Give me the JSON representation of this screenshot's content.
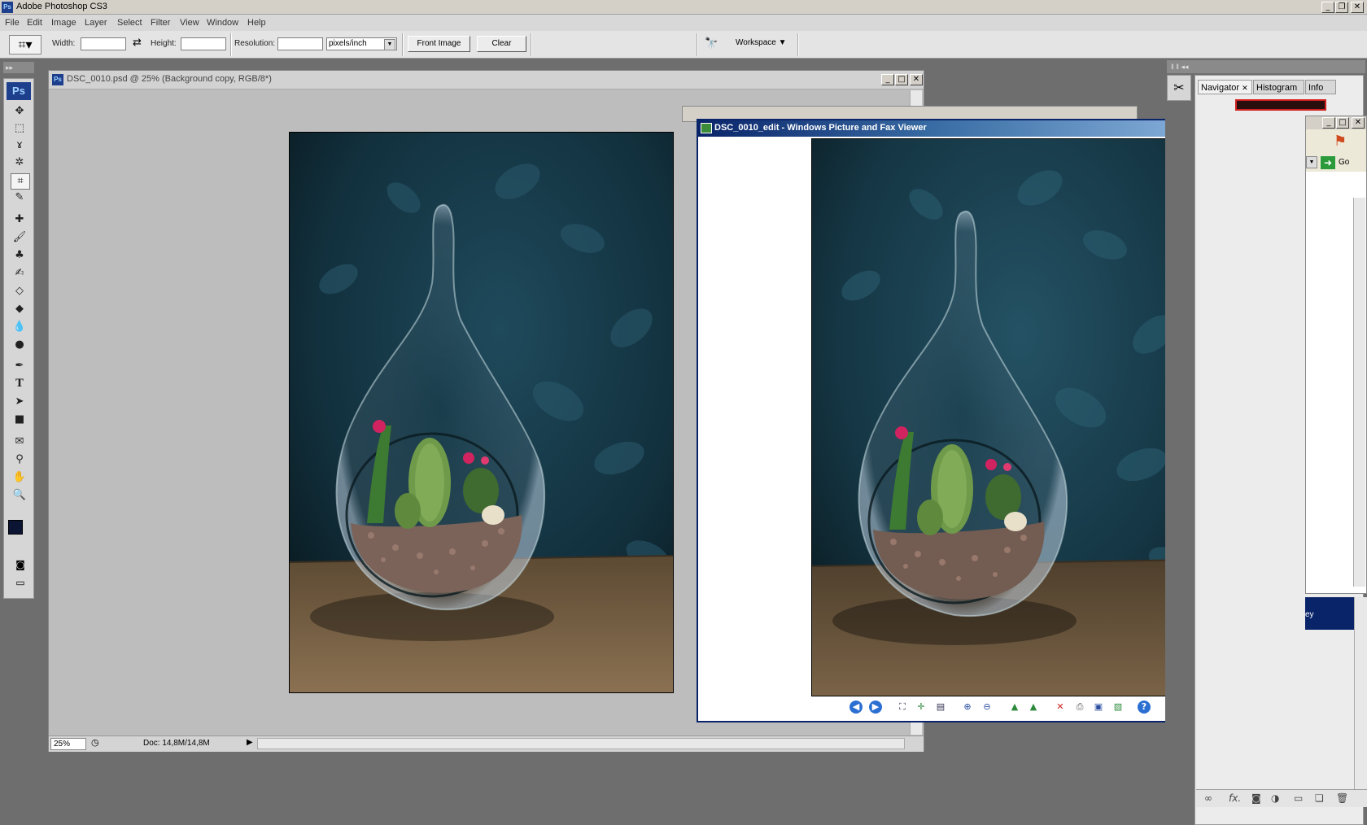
{
  "app": {
    "title": "Adobe Photoshop CS3",
    "icon": "ps-icon"
  },
  "menu": [
    "File",
    "Edit",
    "Image",
    "Layer",
    "Select",
    "Filter",
    "View",
    "Window",
    "Help"
  ],
  "options": {
    "width_label": "Width:",
    "height_label": "Height:",
    "resolution_label": "Resolution:",
    "width_value": "",
    "height_value": "",
    "resolution_value": "",
    "units_value": "pixels/inch",
    "front_image": "Front Image",
    "clear": "Clear",
    "workspace": "Workspace"
  },
  "tools_logo": "Ps",
  "tools": [
    "move-tool",
    "marquee-tool",
    "lasso-tool",
    "magic-wand-tool",
    "crop-tool",
    "slice-tool",
    "healing-brush-tool",
    "brush-tool",
    "clone-stamp-tool",
    "history-brush-tool",
    "eraser-tool",
    "paint-bucket-tool",
    "blur-tool",
    "dodge-tool",
    "pen-tool",
    "type-tool",
    "path-selection-tool",
    "shape-tool",
    "notes-tool",
    "eyedropper-tool",
    "hand-tool",
    "zoom-tool"
  ],
  "tools_glyphs": [
    "✥",
    "⬚",
    "ɤ",
    "✲",
    "⌗",
    "✎",
    "✚",
    "🖌",
    "♣",
    "✍",
    "◇",
    "◆",
    "💧",
    "●",
    "✒",
    "T",
    "➤",
    "■",
    "✉",
    "⚲",
    "✋",
    "🔍"
  ],
  "document": {
    "title": "DSC_0010.psd @ 25% (Background copy, RGB/8*)",
    "zoom": "25%",
    "doc_info": "Doc: 14,8M/14,8M"
  },
  "viewer": {
    "title": "DSC_0010_edit - Windows Picture and Fax Viewer",
    "icons": [
      "previous-image-icon",
      "next-image-icon",
      "best-fit-icon",
      "actual-size-icon",
      "slideshow-icon",
      "zoom-in-icon",
      "zoom-out-icon",
      "rotate-clockwise-icon",
      "rotate-counterclockwise-icon",
      "delete-icon",
      "print-icon",
      "save-icon",
      "open-editor-icon",
      "help-icon"
    ]
  },
  "panels": {
    "tabs": [
      "Navigator",
      "Histogram",
      "Info"
    ],
    "go": "Go",
    "partial_text": "ey"
  },
  "colors": {
    "foreground": "#0b1433",
    "background": "#ffffff",
    "accent": "#0a246a"
  }
}
